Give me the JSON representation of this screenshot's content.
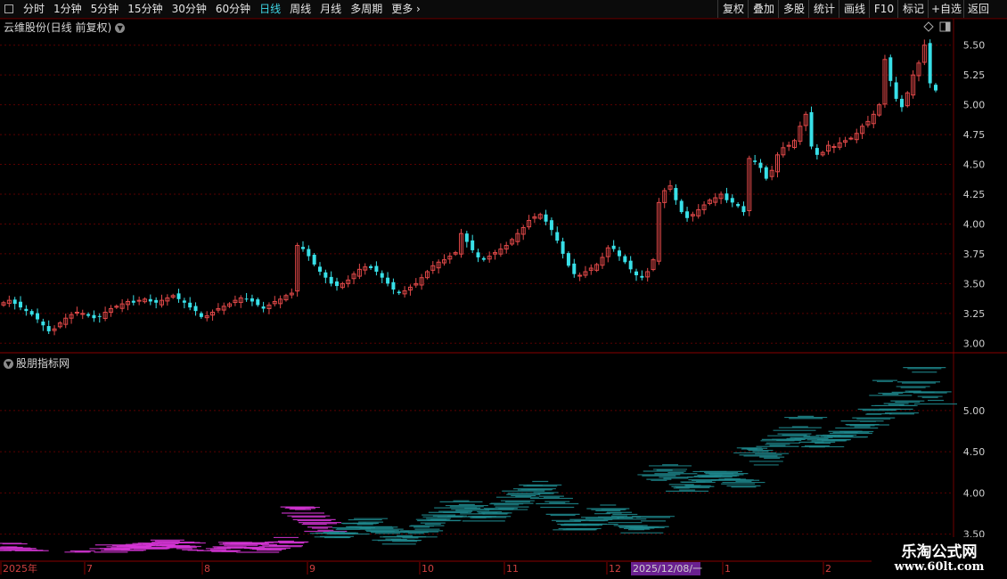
{
  "toolbar": {
    "periods": [
      "分时",
      "1分钟",
      "5分钟",
      "15分钟",
      "30分钟",
      "60分钟",
      "日线",
      "周线",
      "月线",
      "多周期",
      "更多"
    ],
    "active_period": "日线",
    "buttons": [
      "复权",
      "叠加",
      "多股",
      "统计",
      "画线",
      "F10",
      "标记",
      "+自选",
      "返回"
    ]
  },
  "upper_panel": {
    "title": "云维股份(日线 前复权)"
  },
  "lower_panel": {
    "title": "股朋指标网"
  },
  "chart_data": [
    {
      "type": "candlestick",
      "title": "云维股份(日线 前复权)",
      "y_ticks": [
        3.0,
        3.25,
        3.5,
        3.75,
        4.0,
        4.25,
        4.5,
        4.75,
        5.0,
        5.25,
        5.5
      ],
      "ylim": [
        2.95,
        5.58
      ],
      "up_color": "#e04848",
      "down_color": "#38e0e8",
      "x_ticks": [
        "2025年",
        "7",
        "8",
        "9",
        "10",
        "11",
        "12",
        "2025/12/08/一",
        "1",
        "2"
      ],
      "highlighted_date": "2025/12/08/一",
      "close_series": [
        3.34,
        3.36,
        3.33,
        3.3,
        3.27,
        3.24,
        3.2,
        3.15,
        3.1,
        3.12,
        3.17,
        3.21,
        3.24,
        3.26,
        3.25,
        3.23,
        3.21,
        3.22,
        3.26,
        3.29,
        3.31,
        3.33,
        3.35,
        3.34,
        3.36,
        3.37,
        3.35,
        3.34,
        3.36,
        3.38,
        3.4,
        3.37,
        3.34,
        3.3,
        3.27,
        3.22,
        3.23,
        3.26,
        3.29,
        3.31,
        3.33,
        3.36,
        3.38,
        3.37,
        3.35,
        3.32,
        3.29,
        3.32,
        3.35,
        3.37,
        3.4,
        3.42,
        3.82,
        3.79,
        3.73,
        3.66,
        3.6,
        3.55,
        3.5,
        3.48,
        3.5,
        3.53,
        3.58,
        3.62,
        3.64,
        3.63,
        3.6,
        3.55,
        3.5,
        3.45,
        3.42,
        3.44,
        3.47,
        3.5,
        3.55,
        3.6,
        3.65,
        3.68,
        3.7,
        3.73,
        3.76,
        3.92,
        3.85,
        3.78,
        3.72,
        3.7,
        3.73,
        3.76,
        3.79,
        3.82,
        3.87,
        3.92,
        3.97,
        4.03,
        4.06,
        4.08,
        4.02,
        3.95,
        3.86,
        3.75,
        3.65,
        3.58,
        3.57,
        3.6,
        3.63,
        3.66,
        3.72,
        3.8,
        3.79,
        3.73,
        3.68,
        3.62,
        3.57,
        3.55,
        3.6,
        3.7,
        4.18,
        4.28,
        4.32,
        4.2,
        4.1,
        4.05,
        4.08,
        4.12,
        4.16,
        4.2,
        4.22,
        4.25,
        4.2,
        4.18,
        4.15,
        4.1,
        4.55,
        4.52,
        4.47,
        4.38,
        4.45,
        4.58,
        4.64,
        4.66,
        4.7,
        4.82,
        4.92,
        4.65,
        4.58,
        4.6,
        4.66,
        4.65,
        4.68,
        4.7,
        4.72,
        4.76,
        4.82,
        4.86,
        4.92,
        5.0,
        5.38,
        5.2,
        5.05,
        4.98,
        5.1,
        5.25,
        5.35,
        5.5,
        5.18,
        5.12
      ]
    },
    {
      "type": "volume-profile",
      "title": "股朋指标网",
      "y_ticks": [
        3.5,
        4.0,
        4.5,
        5.0
      ],
      "ylim": [
        3.28,
        5.55
      ],
      "colors": [
        "#d635d6",
        "#1f8a8f"
      ]
    }
  ]
}
